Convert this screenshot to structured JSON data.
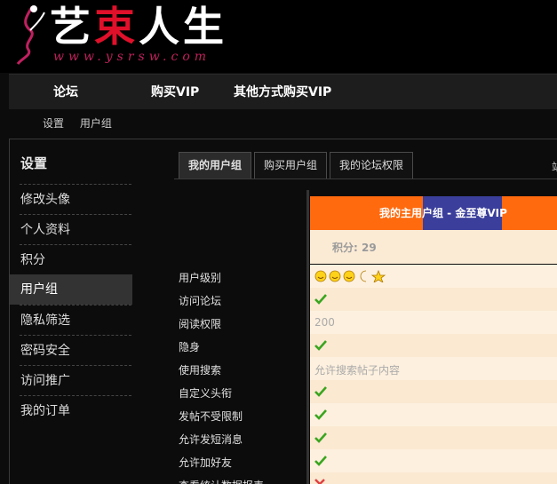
{
  "logo": {
    "char1": "艺",
    "char2": "束",
    "char3": "人生",
    "url": "www.ysrsw.com"
  },
  "nav": {
    "items": [
      "论坛",
      "购买VIP",
      "其他方式购买VIP"
    ]
  },
  "breadcrumb": [
    "设置",
    "用户组"
  ],
  "sidebar": {
    "title": "设置",
    "items": [
      {
        "label": "修改头像"
      },
      {
        "label": "个人资料"
      },
      {
        "label": "积分"
      },
      {
        "label": "用户组",
        "active": true
      },
      {
        "label": "隐私筛选"
      },
      {
        "label": "密码安全"
      },
      {
        "label": "访问推广"
      },
      {
        "label": "我的订单"
      }
    ]
  },
  "tabs": [
    {
      "label": "我的用户组",
      "active": true
    },
    {
      "label": "购买用户组"
    },
    {
      "label": "我的论坛权限"
    }
  ],
  "tab_right_text": "站",
  "group": {
    "title": "我的主用户组 - 金至尊VIP",
    "score": "积分: 29"
  },
  "permissions": [
    {
      "label": "用户级别",
      "type": "stars"
    },
    {
      "label": "访问论坛",
      "type": "check"
    },
    {
      "label": "阅读权限",
      "type": "text",
      "value": "200"
    },
    {
      "label": "隐身",
      "type": "check"
    },
    {
      "label": "使用搜索",
      "type": "text",
      "value": "允许搜索帖子内容"
    },
    {
      "label": "自定义头衔",
      "type": "check"
    },
    {
      "label": "发帖不受限制",
      "type": "check"
    },
    {
      "label": "允许发短消息",
      "type": "check"
    },
    {
      "label": "允许加好友",
      "type": "check"
    },
    {
      "label": "查看统计数据报表",
      "type": "cross"
    }
  ],
  "colors": {
    "accent_orange": "#ff6a0e",
    "accent_blue": "#3b3f9b",
    "row_light": "#fdf0de",
    "row_alt": "#fbe9d2",
    "check_green": "#3aa51f",
    "cross_red": "#e04040"
  }
}
